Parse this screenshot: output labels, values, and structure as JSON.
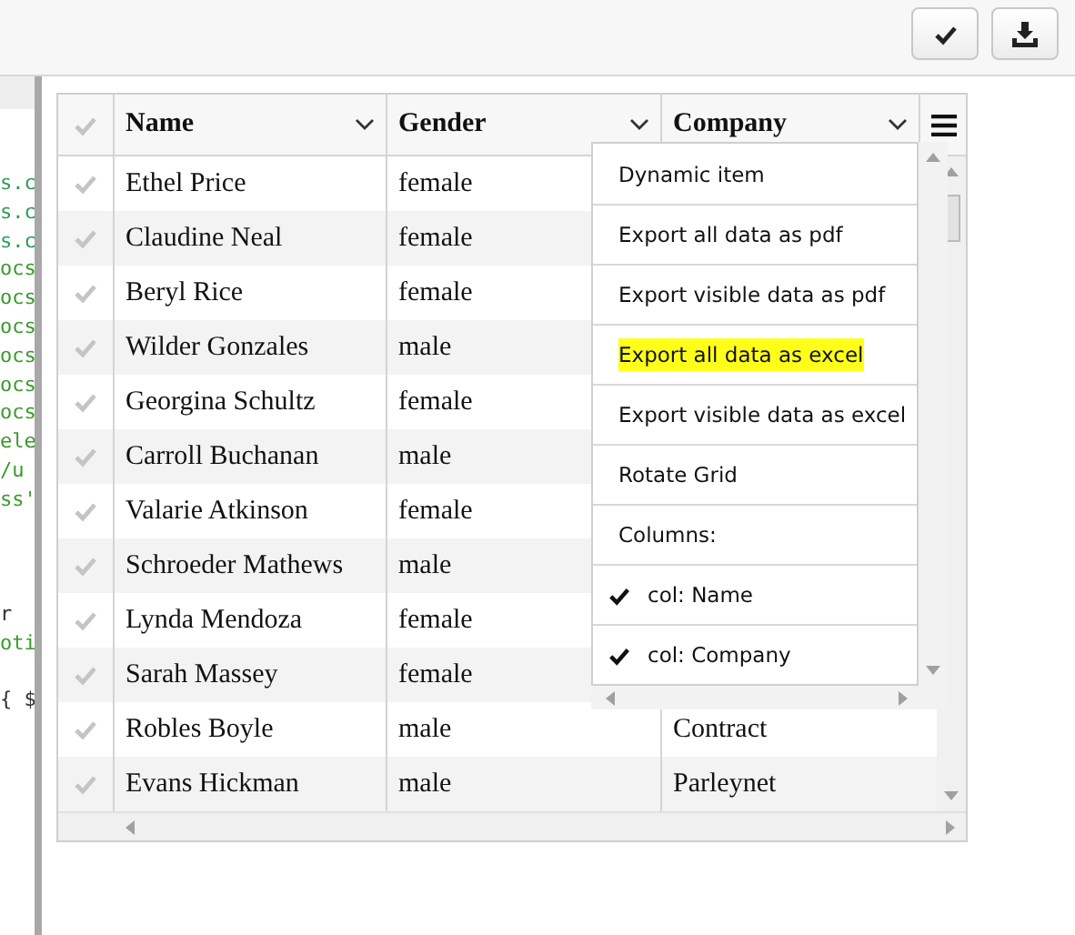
{
  "toolbar": {
    "buttons": [
      {
        "kind": "check"
      },
      {
        "kind": "download"
      }
    ]
  },
  "code_lines": [
    {
      "kind": "code",
      "text": "s.c",
      "color": "#2e9a5a"
    },
    {
      "kind": "code",
      "text": "s.c",
      "color": "#2e9a5a"
    },
    {
      "kind": "code",
      "text": "s.c",
      "color": "#2e9a5a"
    },
    {
      "kind": "code",
      "text": "ocs",
      "color": "#3a9a2a"
    },
    {
      "kind": "code",
      "text": "ocs",
      "color": "#3a9a2a"
    },
    {
      "kind": "code",
      "text": "ocs",
      "color": "#3a9a2a"
    },
    {
      "kind": "code",
      "text": "ocs",
      "color": "#3a9a2a"
    },
    {
      "kind": "code",
      "text": "ocs",
      "color": "#3a9a2a"
    },
    {
      "kind": "code",
      "text": "ocs",
      "color": "#3a9a2a"
    },
    {
      "kind": "code",
      "text": "ele",
      "color": "#3a9a2a"
    },
    {
      "kind": "code",
      "text": "/u",
      "color": "#3a9a2a"
    },
    {
      "kind": "code",
      "text": "ss'",
      "color": "#3a9a2a"
    },
    {
      "kind": "blank"
    },
    {
      "kind": "blank"
    },
    {
      "kind": "blank"
    },
    {
      "kind": "code",
      "text": "r",
      "color": "#333333"
    },
    {
      "kind": "code",
      "text": "oti",
      "color": "#3a9a2a"
    },
    {
      "kind": "blank"
    },
    {
      "kind": "code",
      "text": "{ $",
      "color": "#333333"
    }
  ],
  "grid": {
    "columns": [
      {
        "label": "Name"
      },
      {
        "label": "Gender"
      },
      {
        "label": "Company"
      }
    ],
    "rows": [
      {
        "name": "Ethel Price",
        "gender": "female"
      },
      {
        "name": "Claudine Neal",
        "gender": "female"
      },
      {
        "name": "Beryl Rice",
        "gender": "female"
      },
      {
        "name": "Wilder Gonzales",
        "gender": "male"
      },
      {
        "name": "Georgina Schultz",
        "gender": "female"
      },
      {
        "name": "Carroll Buchanan",
        "gender": "male"
      },
      {
        "name": "Valarie Atkinson",
        "gender": "female"
      },
      {
        "name": "Schroeder Mathews",
        "gender": "male"
      },
      {
        "name": "Lynda Mendoza",
        "gender": "female"
      },
      {
        "name": "Sarah Massey",
        "gender": "female"
      },
      {
        "name": "Robles Boyle",
        "gender": "male",
        "company": "Contract"
      },
      {
        "name": "Evans Hickman",
        "gender": "male",
        "company": "Parleynet"
      }
    ],
    "menu": [
      {
        "kind": "action",
        "label": "Dynamic item",
        "highlighted": false
      },
      {
        "kind": "action",
        "label": "Export all data as pdf",
        "highlighted": false
      },
      {
        "kind": "action",
        "label": "Export visible data as pdf",
        "highlighted": false
      },
      {
        "kind": "action",
        "label": "Export all data as excel",
        "highlighted": true
      },
      {
        "kind": "action",
        "label": "Export visible data as excel",
        "highlighted": false
      },
      {
        "kind": "action",
        "label": "Rotate Grid",
        "highlighted": false
      },
      {
        "kind": "heading",
        "label": "Columns:"
      },
      {
        "kind": "column",
        "label": "col: Name",
        "checked": true
      },
      {
        "kind": "column",
        "label": "col: Company",
        "checked": true
      }
    ]
  }
}
